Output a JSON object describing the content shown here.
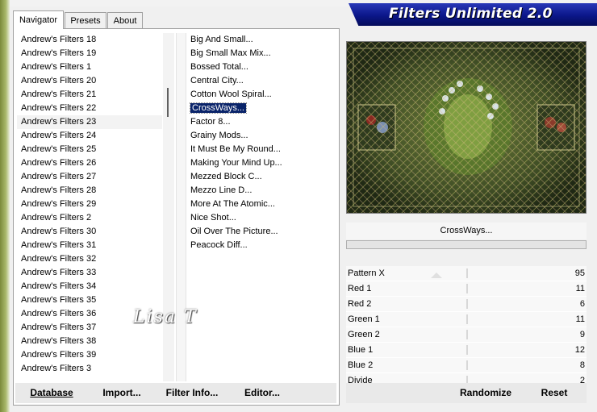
{
  "window": {
    "title": "Filters Unlimited 2.0"
  },
  "tabs": [
    {
      "label": "Navigator",
      "active": true
    },
    {
      "label": "Presets"
    },
    {
      "label": "About"
    }
  ],
  "categories": {
    "items": [
      "Andrew's Filters 18",
      "Andrew's Filters 19",
      "Andrew's Filters 1",
      "Andrew's Filters 20",
      "Andrew's Filters 21",
      "Andrew's Filters 22",
      "Andrew's Filters 23",
      "Andrew's Filters 24",
      "Andrew's Filters 25",
      "Andrew's Filters 26",
      "Andrew's Filters 27",
      "Andrew's Filters 28",
      "Andrew's Filters 29",
      "Andrew's Filters 2",
      "Andrew's Filters 30",
      "Andrew's Filters 31",
      "Andrew's Filters 32",
      "Andrew's Filters 33",
      "Andrew's Filters 34",
      "Andrew's Filters 35",
      "Andrew's Filters 36",
      "Andrew's Filters 37",
      "Andrew's Filters 38",
      "Andrew's Filters 39",
      "Andrew's Filters 3"
    ],
    "selected": "Andrew's Filters 23"
  },
  "filters": {
    "items": [
      "Big And Small...",
      "Big Small Max Mix...",
      "Bossed Total...",
      "Central City...",
      "Cotton Wool Spiral...",
      "CrossWays...",
      "Factor 8...",
      "Grainy Mods...",
      "It Must Be My Round...",
      "Making Your Mind Up...",
      "Mezzed Block C...",
      "Mezzo Line D...",
      "More At The Atomic...",
      "Nice Shot...",
      "Oil Over The Picture...",
      "Peacock Diff..."
    ],
    "selected": "CrossWays..."
  },
  "preview": {
    "filter_name": "CrossWays..."
  },
  "params": [
    {
      "label": "Pattern X",
      "value": "95"
    },
    {
      "label": "Red 1",
      "value": "11"
    },
    {
      "label": "Red 2",
      "value": "6"
    },
    {
      "label": "Green 1",
      "value": "11"
    },
    {
      "label": "Green 2",
      "value": "9"
    },
    {
      "label": "Blue 1",
      "value": "12"
    },
    {
      "label": "Blue 2",
      "value": "8"
    },
    {
      "label": "Divide",
      "value": "2"
    }
  ],
  "buttons": {
    "database": "Database",
    "import": "Import...",
    "filter_info": "Filter Info...",
    "editor": "Editor...",
    "randomize": "Randomize",
    "reset": "Reset"
  },
  "watermark": "Lisa T",
  "colors": {
    "banner": "#0b1689",
    "selection": "#0a246a",
    "frame_green": "#7b8a3a"
  }
}
